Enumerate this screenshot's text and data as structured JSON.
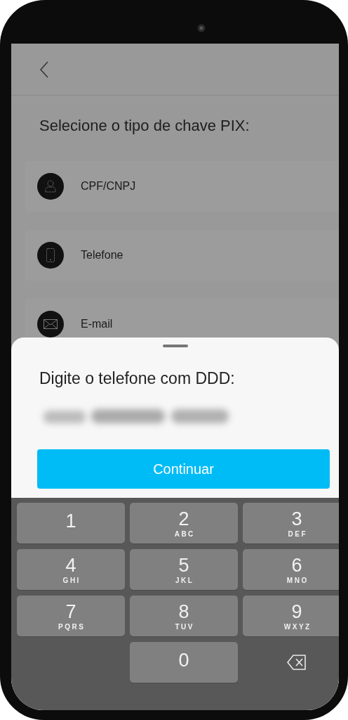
{
  "header": {
    "title": "Selecione o tipo de chave PIX:"
  },
  "key_types": [
    {
      "label": "CPF/CNPJ",
      "kind": "person"
    },
    {
      "label": "Telefone",
      "kind": "phone"
    },
    {
      "label": "E-mail",
      "kind": "email"
    }
  ],
  "sheet": {
    "heading": "Digite o telefone com DDD:",
    "phone_field": {
      "redacted": true
    },
    "button": "Continuar"
  },
  "keypad": {
    "keys": [
      {
        "kind": "digit",
        "digit": "1"
      },
      {
        "kind": "digit",
        "digit": "2",
        "letters": "ABC"
      },
      {
        "kind": "digit",
        "digit": "3",
        "letters": "DEF"
      },
      {
        "kind": "digit",
        "digit": "4",
        "letters": "GHI"
      },
      {
        "kind": "digit",
        "digit": "5",
        "letters": "JKL"
      },
      {
        "kind": "digit",
        "digit": "6",
        "letters": "MNO"
      },
      {
        "kind": "digit",
        "digit": "7",
        "letters": "PQRS"
      },
      {
        "kind": "digit",
        "digit": "8",
        "letters": "TUV"
      },
      {
        "kind": "digit",
        "digit": "9",
        "letters": "WXYZ"
      },
      {
        "kind": "blank"
      },
      {
        "kind": "digit",
        "digit": "0"
      },
      {
        "kind": "delete"
      }
    ]
  }
}
